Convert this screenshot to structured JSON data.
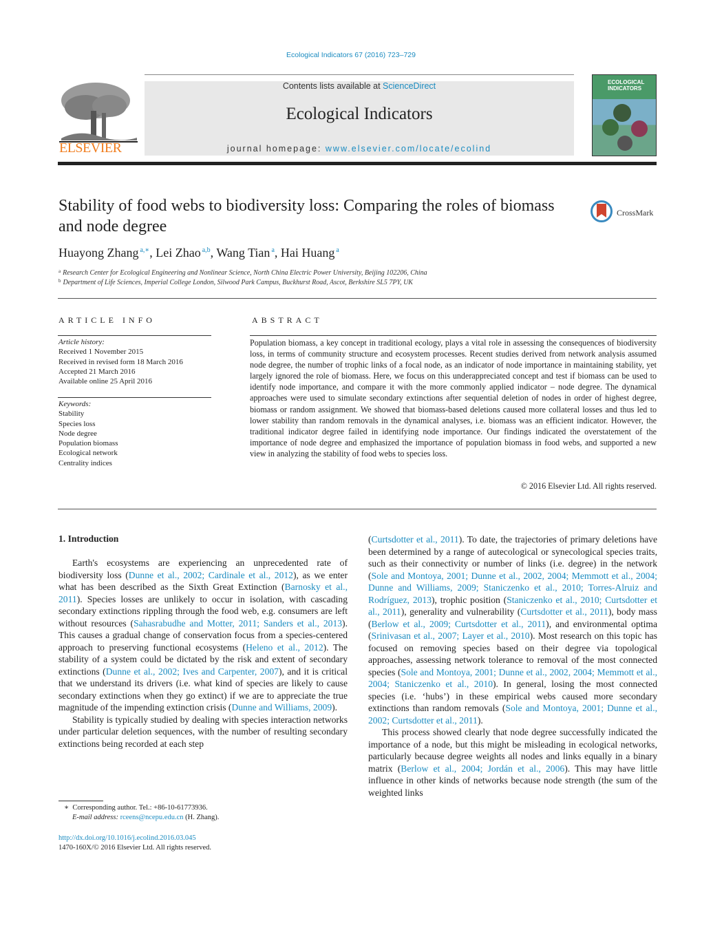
{
  "header": {
    "citation": "Ecological Indicators 67 (2016) 723–729",
    "contents_prefix": "Contents lists available at ",
    "contents_link": "ScienceDirect",
    "journal_title": "Ecological Indicators",
    "homepage_prefix": "journal homepage: ",
    "homepage_link": "www.elsevier.com/locate/ecolind",
    "publisher_logo": "ELSEVIER",
    "cover_title_line1": "ECOLOGICAL",
    "cover_title_line2": "INDICATORS",
    "crossmark_label": "CrossMark"
  },
  "article": {
    "title": "Stability of food webs to biodiversity loss: Comparing the roles of biomass and node degree",
    "authors": [
      {
        "name": "Huayong Zhang",
        "sup": "a,∗",
        "sep": ", "
      },
      {
        "name": "Lei Zhao",
        "sup": "a,b",
        "sep": ", "
      },
      {
        "name": "Wang Tian",
        "sup": "a",
        "sep": ", "
      },
      {
        "name": "Hai Huang",
        "sup": "a",
        "sep": ""
      }
    ],
    "affiliations": [
      {
        "key": "a",
        "text": "Research Center for Ecological Engineering and Nonlinear Science, North China Electric Power University, Beijing 102206, China"
      },
      {
        "key": "b",
        "text": "Department of Life Sciences, Imperial College London, Silwood Park Campus, Buckhurst Road, Ascot, Berkshire SL5 7PY, UK"
      }
    ]
  },
  "article_info": {
    "heading": "ARTICLE INFO",
    "history_label": "Article history:",
    "history": [
      "Received 1 November 2015",
      "Received in revised form 18 March 2016",
      "Accepted 21 March 2016",
      "Available online 25 April 2016"
    ],
    "keywords_label": "Keywords:",
    "keywords": [
      "Stability",
      "Species loss",
      "Node degree",
      "Population biomass",
      "Ecological network",
      "Centrality indices"
    ]
  },
  "abstract": {
    "heading": "ABSTRACT",
    "text": "Population biomass, a key concept in traditional ecology, plays a vital role in assessing the consequences of biodiversity loss, in terms of community structure and ecosystem processes. Recent studies derived from network analysis assumed node degree, the number of trophic links of a focal node, as an indicator of node importance in maintaining stability, yet largely ignored the role of biomass. Here, we focus on this underappreciated concept and test if biomass can be used to identify node importance, and compare it with the more commonly applied indicator – node degree. The dynamical approaches were used to simulate secondary extinctions after sequential deletion of nodes in order of highest degree, biomass or random assignment. We showed that biomass-based deletions caused more collateral losses and thus led to lower stability than random removals in the dynamical analyses, i.e. biomass was an efficient indicator. However, the traditional indicator degree failed in identifying node importance. Our findings indicated the overstatement of the importance of node degree and emphasized the importance of population biomass in food webs, and supported a new view in analyzing the stability of food webs to species loss.",
    "copyright": "© 2016 Elsevier Ltd. All rights reserved."
  },
  "introduction": {
    "heading": "1.  Introduction",
    "left_paragraphs": [
      [
        {
          "t": "Earth's ecosystems are experiencing an unprecedented rate of biodiversity loss ("
        },
        {
          "l": "Dunne et al., 2002; Cardinale et al., 2012"
        },
        {
          "t": "), as we enter what has been described as the Sixth Great Extinction ("
        },
        {
          "l": "Barnosky et al., 2011"
        },
        {
          "t": "). Species losses are unlikely to occur in isolation, with cascading secondary extinctions rippling through the food web, e.g. consumers are left without resources ("
        },
        {
          "l": "Sahasrabudhe and Motter, 2011; Sanders et al., 2013"
        },
        {
          "t": "). This causes a gradual change of conservation focus from a species-centered approach to preserving functional ecosystems ("
        },
        {
          "l": "Heleno et al., 2012"
        },
        {
          "t": "). The stability of a system could be dictated by the risk and extent of secondary extinctions ("
        },
        {
          "l": "Dunne et al., 2002; Ives and Carpenter, 2007"
        },
        {
          "t": "), and it is critical that we understand its drivers (i.e. what kind of species are likely to cause secondary extinctions when they go extinct) if we are to appreciate the true magnitude of the impending extinction crisis ("
        },
        {
          "l": "Dunne and Williams, 2009"
        },
        {
          "t": ")."
        }
      ],
      [
        {
          "t": "Stability is typically studied by dealing with species interaction networks under particular deletion sequences, with the number of resulting secondary extinctions being recorded at each step"
        }
      ]
    ],
    "right_paragraphs": [
      [
        {
          "t": "("
        },
        {
          "l": "Curtsdotter et al., 2011"
        },
        {
          "t": "). To date, the trajectories of primary deletions have been determined by a range of autecological or synecological species traits, such as their connectivity or number of links (i.e. degree) in the network ("
        },
        {
          "l": "Sole and Montoya, 2001; Dunne et al., 2002, 2004; Memmott et al., 2004; Dunne and Williams, 2009; Staniczenko et al., 2010; Torres-Alruiz and Rodríguez, 2013"
        },
        {
          "t": "), trophic position ("
        },
        {
          "l": "Staniczenko et al., 2010; Curtsdotter et al., 2011"
        },
        {
          "t": "), generality and vulnerability ("
        },
        {
          "l": "Curtsdotter et al., 2011"
        },
        {
          "t": "), body mass ("
        },
        {
          "l": "Berlow et al., 2009; Curtsdotter et al., 2011"
        },
        {
          "t": "), and environmental optima ("
        },
        {
          "l": "Srinivasan et al., 2007; Layer et al., 2010"
        },
        {
          "t": "). Most research on this topic has focused on removing species based on their degree via topological approaches, assessing network tolerance to removal of the most connected species ("
        },
        {
          "l": "Sole and Montoya, 2001; Dunne et al., 2002, 2004; Memmott et al., 2004; Staniczenko et al., 2010"
        },
        {
          "t": "). In general, losing the most connected species (i.e. ‘hubs’) in these empirical webs caused more secondary extinctions than random removals ("
        },
        {
          "l": "Sole and Montoya, 2001; Dunne et al., 2002; Curtsdotter et al., 2011"
        },
        {
          "t": ")."
        }
      ],
      [
        {
          "t": "This process showed clearly that node degree successfully indicated the importance of a node, but this might be misleading in ecological networks, particularly because degree weights all nodes and links equally in a binary matrix ("
        },
        {
          "l": "Berlow et al., 2004; Jordán et al., 2006"
        },
        {
          "t": "). This may have little influence in other kinds of networks because node strength (the sum of the weighted links"
        }
      ]
    ]
  },
  "footnotes": {
    "corresponding_marker": "∗",
    "corresponding": "Corresponding author. Tel.: +86-10-61773936.",
    "email_label": "E-mail address: ",
    "email": "rceens@ncepu.edu.cn",
    "email_suffix": " (H. Zhang).",
    "doi": "http://dx.doi.org/10.1016/j.ecolind.2016.03.045",
    "issn": "1470-160X/© 2016 Elsevier Ltd. All rights reserved."
  }
}
